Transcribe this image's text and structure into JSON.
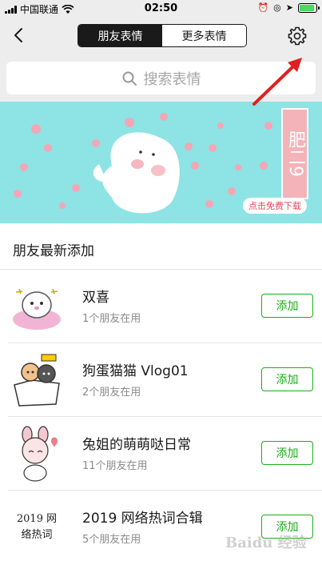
{
  "status": {
    "carrier": "中国联通",
    "time": "02:50"
  },
  "nav": {
    "tab_active": "朋友表情",
    "tab_inactive": "更多表情"
  },
  "search": {
    "placeholder": "搜索表情"
  },
  "banner": {
    "tag": "肥二9",
    "download": "点击免费下载",
    "bg_color": "#8ee3e4"
  },
  "section": {
    "title": "朋友最新添加"
  },
  "items": [
    {
      "name": "双喜",
      "sub": "1个朋友在用",
      "button": "添加"
    },
    {
      "name": "狗蛋猫猫 Vlog01",
      "sub": "2个朋友在用",
      "button": "添加"
    },
    {
      "name": "兔姐的萌萌哒日常",
      "sub": "11个朋友在用",
      "button": "添加"
    },
    {
      "name": "2019 网络热词合辑",
      "sub": "5个朋友在用",
      "button": "添加"
    }
  ],
  "thumb4_text": "2019 网络热词",
  "colors": {
    "accent_green": "#1aad19",
    "annotation_red": "#e02020"
  },
  "watermark": "Baidu 经验"
}
